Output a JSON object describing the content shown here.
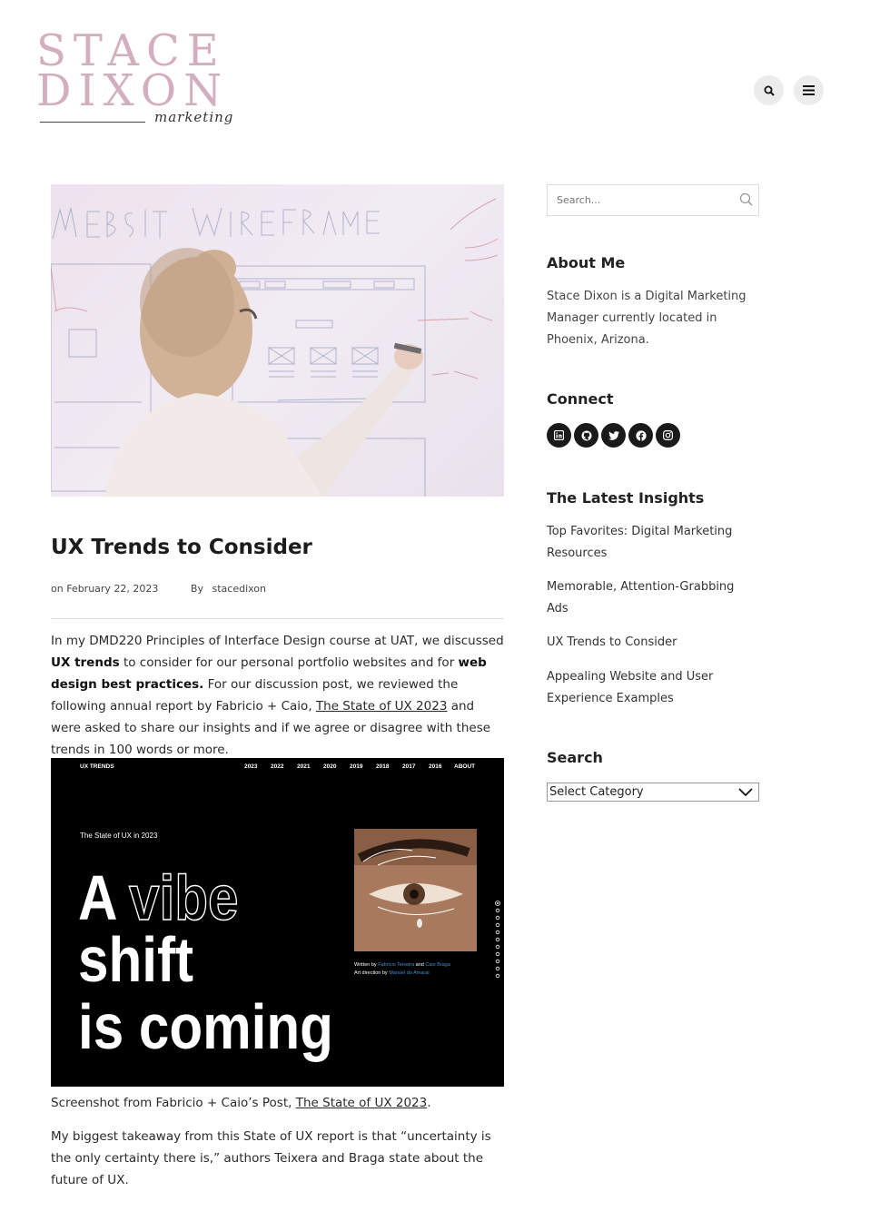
{
  "header": {
    "logo_line1": "STACE",
    "logo_line2": "DIXON",
    "logo_script": "marketing",
    "search_icon": "search-icon",
    "menu_icon": "hamburger-menu-icon"
  },
  "post": {
    "title": "UX Trends to Consider",
    "date": "on February 22, 2023",
    "by_label": "By",
    "author": "stacedixon",
    "p1_a": "In my DMD220 Principles of Interface Design course at UAT, we discussed ",
    "p1_b1": "UX trends",
    "p1_c": " to consider for our personal portfolio websites and for ",
    "p1_b2": "web design best practices.",
    "p1_d": " For our discussion post, we reviewed the following annual report by Fabricio + Caio, ",
    "p1_link": "The State of UX 2023",
    "p1_e": " and were asked to share our insights and if we agree or disagree with these trends in 100 words or more.",
    "caption_text": "Screenshot from Fabricio + Caio’s Post, ",
    "caption_link": "The State of UX 2023",
    "caption_end": ".",
    "p2": "My biggest takeaway from this State of UX report is that “uncertainty is the only certainty there is,” authors Teixera and Braga state about the future of UX."
  },
  "screenshot": {
    "brand": "UX TRENDS",
    "nav": [
      "2023",
      "2022",
      "2021",
      "2020",
      "2019",
      "2018",
      "2017",
      "2016",
      "ABOUT"
    ],
    "kicker": "The State of UX in 2023",
    "headline_1a": "A ",
    "headline_1b": "vibe",
    "headline_2": "shift",
    "headline_3": "is coming",
    "credit_written_prefix": "Written by ",
    "credit_written_name1": "Fabricio Teixeira",
    "credit_and": " and ",
    "credit_written_name2": "Caio Braga",
    "credit_art_prefix": "Art direction by ",
    "credit_art_name": "Manuel do Amaral"
  },
  "sidebar": {
    "search_placeholder": "Search...",
    "about_heading": "About Me",
    "about_text": "Stace Dixon is a Digital Marketing Manager currently located in Phoenix, Arizona.",
    "connect_heading": "Connect",
    "social_icons": [
      "linkedin-icon",
      "github-icon",
      "twitter-icon",
      "facebook-icon",
      "instagram-icon"
    ],
    "insights_heading": "The Latest Insights",
    "insights": [
      "Top Favorites: Digital Marketing Resources",
      "Memorable, Attention-Grabbing Ads",
      "UX Trends to Consider",
      "Appealing Website and User Experience Examples"
    ],
    "search_heading": "Search",
    "category_selected": "Select Category"
  },
  "colors": {
    "logo_pink": "#d3aebe",
    "link_blue": "#3b8fd6"
  }
}
